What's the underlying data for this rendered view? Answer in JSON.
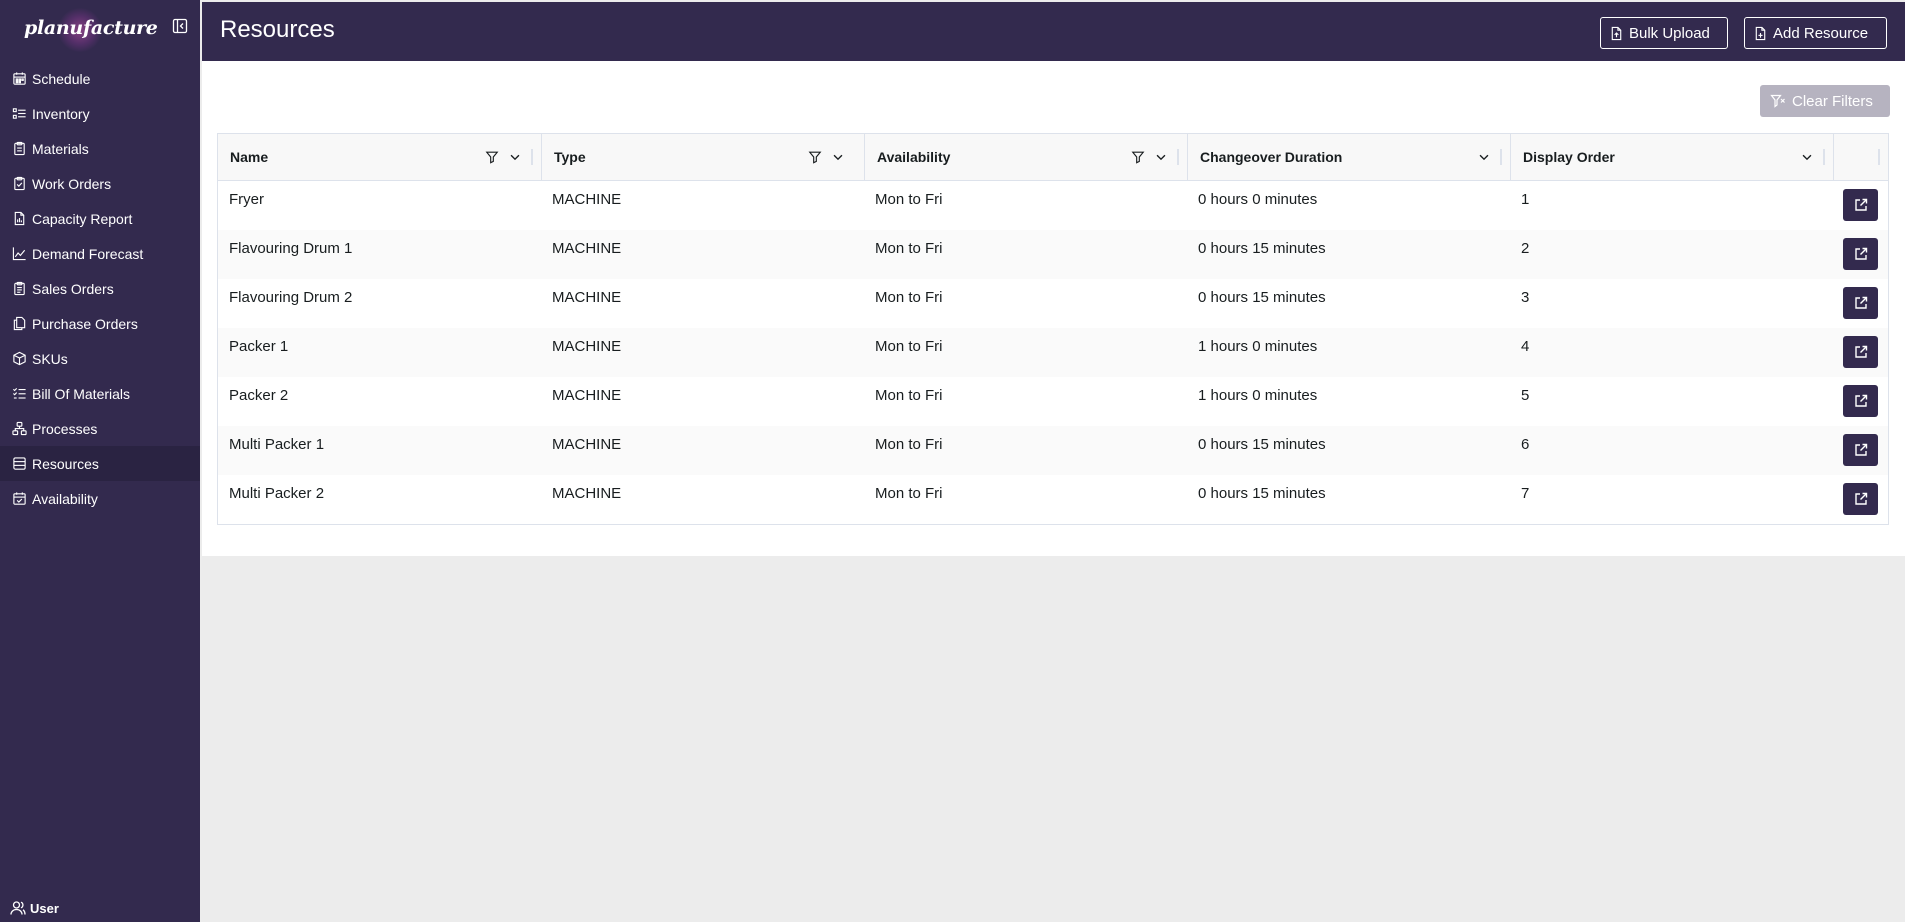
{
  "brand": {
    "logo_text": "planufacture"
  },
  "sidebar": {
    "items": [
      {
        "label": "Schedule",
        "icon": "calendar-icon"
      },
      {
        "label": "Inventory",
        "icon": "list-icon"
      },
      {
        "label": "Materials",
        "icon": "clipboard-icon"
      },
      {
        "label": "Work Orders",
        "icon": "clipboard-check-icon"
      },
      {
        "label": "Capacity Report",
        "icon": "report-icon"
      },
      {
        "label": "Demand Forecast",
        "icon": "line-chart-icon"
      },
      {
        "label": "Sales Orders",
        "icon": "clipboard-list-icon"
      },
      {
        "label": "Purchase Orders",
        "icon": "copy-icon"
      },
      {
        "label": "SKUs",
        "icon": "box-icon"
      },
      {
        "label": "Bill Of Materials",
        "icon": "checklist-icon"
      },
      {
        "label": "Processes",
        "icon": "workflow-icon"
      },
      {
        "label": "Resources",
        "icon": "database-icon",
        "active": true
      },
      {
        "label": "Availability",
        "icon": "calendar-check-icon"
      }
    ],
    "user_label": "User"
  },
  "header": {
    "title": "Resources",
    "bulk_upload_label": "Bulk Upload",
    "add_resource_label": "Add Resource"
  },
  "toolbar": {
    "clear_filters_label": "Clear Filters"
  },
  "table": {
    "columns": [
      "Name",
      "Type",
      "Availability",
      "Changeover Duration",
      "Display Order"
    ],
    "rows": [
      {
        "name": "Fryer",
        "type": "MACHINE",
        "availability": "Mon to Fri",
        "changeover": "0 hours 0 minutes",
        "order": "1"
      },
      {
        "name": "Flavouring Drum 1",
        "type": "MACHINE",
        "availability": "Mon to Fri",
        "changeover": "0 hours 15 minutes",
        "order": "2"
      },
      {
        "name": "Flavouring Drum 2",
        "type": "MACHINE",
        "availability": "Mon to Fri",
        "changeover": "0 hours 15 minutes",
        "order": "3"
      },
      {
        "name": "Packer 1",
        "type": "MACHINE",
        "availability": "Mon to Fri",
        "changeover": "1 hours 0 minutes",
        "order": "4"
      },
      {
        "name": "Packer 2",
        "type": "MACHINE",
        "availability": "Mon to Fri",
        "changeover": "1 hours 0 minutes",
        "order": "5"
      },
      {
        "name": "Multi Packer 1",
        "type": "MACHINE",
        "availability": "Mon to Fri",
        "changeover": "0 hours 15 minutes",
        "order": "6"
      },
      {
        "name": "Multi Packer 2",
        "type": "MACHINE",
        "availability": "Mon to Fri",
        "changeover": "0 hours 15 minutes",
        "order": "7"
      }
    ]
  },
  "colors": {
    "primary": "#332a4e",
    "sidebar_active": "#2a2342",
    "clear_filters_disabled": "#b6b3c0",
    "page_bg": "#ececec"
  }
}
